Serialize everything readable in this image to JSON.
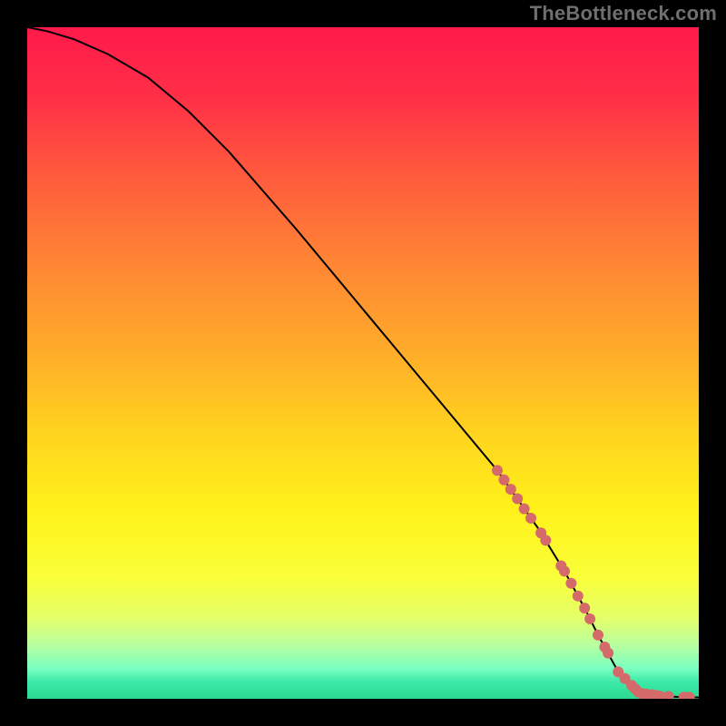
{
  "watermark": {
    "text": "TheBottleneck.com"
  },
  "colors": {
    "background": "#000000",
    "watermark": "#6f6f6f",
    "curve": "#000000",
    "points": "#d46a6a",
    "gradient_stops": [
      {
        "offset": 0.0,
        "color": "#ff1a4b"
      },
      {
        "offset": 0.1,
        "color": "#ff2e46"
      },
      {
        "offset": 0.22,
        "color": "#ff5a3d"
      },
      {
        "offset": 0.35,
        "color": "#ff8534"
      },
      {
        "offset": 0.48,
        "color": "#ffab2a"
      },
      {
        "offset": 0.6,
        "color": "#ffd21f"
      },
      {
        "offset": 0.72,
        "color": "#fff21a"
      },
      {
        "offset": 0.82,
        "color": "#f9ff3a"
      },
      {
        "offset": 0.88,
        "color": "#e4ff6a"
      },
      {
        "offset": 0.92,
        "color": "#b8ffa0"
      },
      {
        "offset": 0.955,
        "color": "#7affc0"
      },
      {
        "offset": 0.975,
        "color": "#3de9a8"
      },
      {
        "offset": 1.0,
        "color": "#2bd990"
      }
    ]
  },
  "chart_data": {
    "type": "line",
    "title": "",
    "xlabel": "",
    "ylabel": "",
    "xlim": [
      0,
      100
    ],
    "ylim": [
      0,
      100
    ],
    "curve": {
      "x": [
        0,
        3,
        7,
        12,
        18,
        24,
        30,
        40,
        50,
        60,
        70,
        76,
        80,
        83,
        85,
        88,
        92,
        96,
        100
      ],
      "y": [
        100,
        99.4,
        98.2,
        96.0,
        92.5,
        87.5,
        81.5,
        70.0,
        58.0,
        46.0,
        34.0,
        25.5,
        19.0,
        13.5,
        9.5,
        4.0,
        0.8,
        0.3,
        0.2
      ]
    },
    "points_on_curve": [
      {
        "x": 70.0,
        "y": 34.0
      },
      {
        "x": 71.0,
        "y": 32.6
      },
      {
        "x": 72.0,
        "y": 31.2
      },
      {
        "x": 73.0,
        "y": 29.8
      },
      {
        "x": 74.0,
        "y": 28.3
      },
      {
        "x": 75.0,
        "y": 26.9
      },
      {
        "x": 76.5,
        "y": 24.7
      },
      {
        "x": 77.2,
        "y": 23.6
      },
      {
        "x": 79.5,
        "y": 19.8
      },
      {
        "x": 80.0,
        "y": 19.0
      },
      {
        "x": 81.0,
        "y": 17.2
      },
      {
        "x": 82.0,
        "y": 15.3
      },
      {
        "x": 83.0,
        "y": 13.5
      },
      {
        "x": 83.8,
        "y": 11.9
      },
      {
        "x": 85.0,
        "y": 9.5
      },
      {
        "x": 86.0,
        "y": 7.7
      },
      {
        "x": 86.5,
        "y": 6.8
      },
      {
        "x": 88.0,
        "y": 4.0
      },
      {
        "x": 89.0,
        "y": 3.0
      },
      {
        "x": 90.0,
        "y": 2.0
      },
      {
        "x": 90.5,
        "y": 1.5
      },
      {
        "x": 91.0,
        "y": 1.0
      },
      {
        "x": 91.5,
        "y": 0.8
      },
      {
        "x": 92.2,
        "y": 0.7
      },
      {
        "x": 93.0,
        "y": 0.6
      },
      {
        "x": 93.6,
        "y": 0.5
      },
      {
        "x": 94.2,
        "y": 0.4
      },
      {
        "x": 95.5,
        "y": 0.35
      },
      {
        "x": 97.8,
        "y": 0.25
      },
      {
        "x": 98.6,
        "y": 0.22
      }
    ],
    "point_radius": 6
  }
}
